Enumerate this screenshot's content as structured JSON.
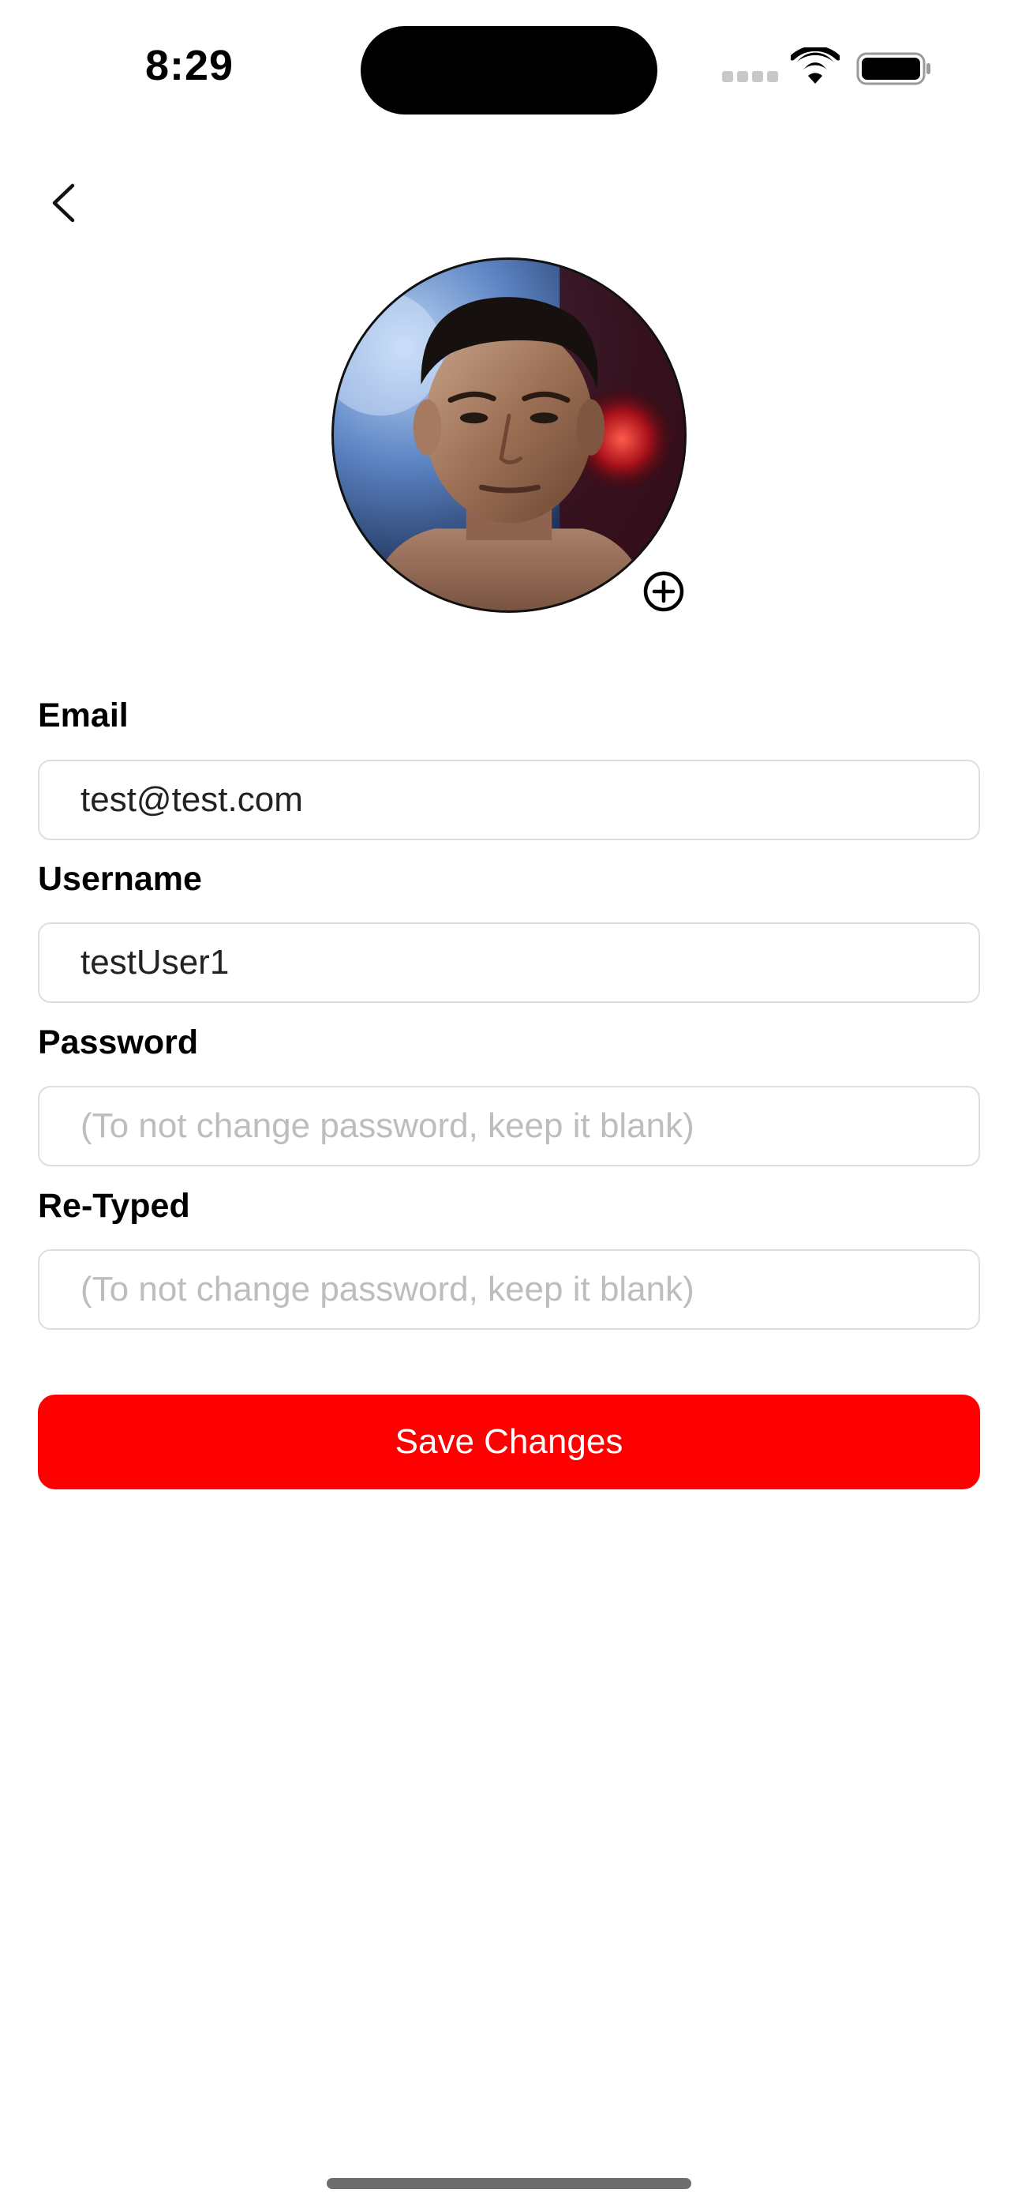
{
  "status_bar": {
    "time": "8:29",
    "icons": [
      "cellular-signal-icon",
      "wifi-icon",
      "battery-icon"
    ]
  },
  "nav": {
    "back_icon": "chevron-left-icon"
  },
  "profile": {
    "avatar_icon": "profile-photo",
    "add_photo_icon": "plus-circle-icon"
  },
  "form": {
    "email": {
      "label": "Email",
      "value": "test@test.com"
    },
    "username": {
      "label": "Username",
      "value": "testUser1"
    },
    "password": {
      "label": "Password",
      "placeholder": "(To not change password, keep it blank)"
    },
    "retyped": {
      "label": "Re-Typed",
      "placeholder": "(To not change password, keep it blank)"
    }
  },
  "actions": {
    "save_label": "Save Changes"
  },
  "colors": {
    "primary": "#ff0000",
    "input_border": "#dedede",
    "placeholder": "#bdbdbd"
  }
}
